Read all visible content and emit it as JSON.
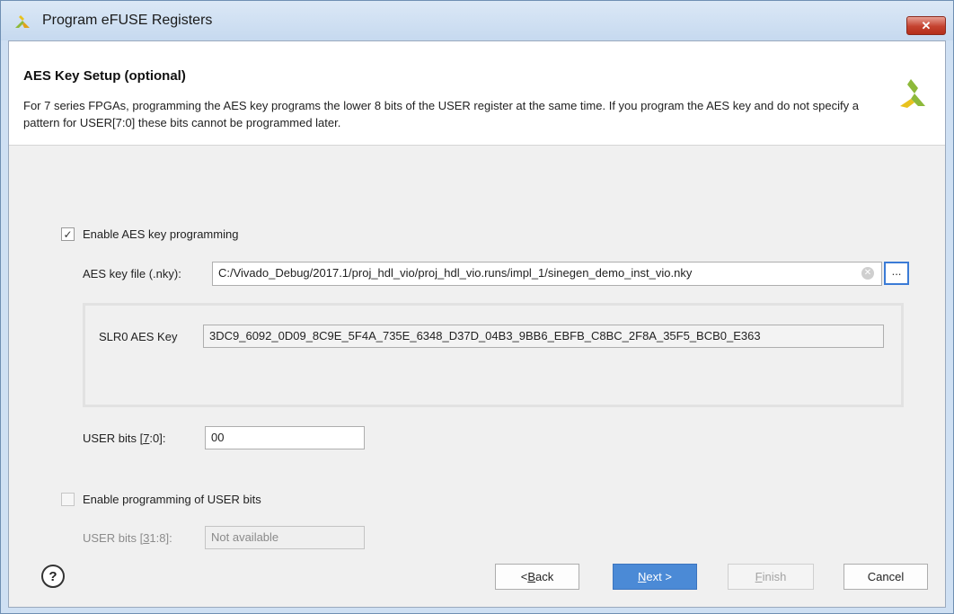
{
  "window": {
    "title": "Program eFUSE Registers",
    "close_symbol": "✕"
  },
  "header": {
    "title": "AES Key Setup (optional)",
    "description": "For 7 series FPGAs, programming the AES key programs the lower 8 bits of the USER register at the same time. If you program the AES key and do not specify a pattern for USER[7:0] these bits cannot be programmed later."
  },
  "aes": {
    "enable_label": "Enable AES key programming",
    "enable_checked": true,
    "file_label": "AES key file (.nky):",
    "file_value": "C:/Vivado_Debug/2017.1/proj_hdl_vio/proj_hdl_vio.runs/impl_1/sinegen_demo_inst_vio.nky",
    "browse_label": "...",
    "slr_label": "SLR0 AES Key",
    "slr_value": "3DC9_6092_0D09_8C9E_5F4A_735E_6348_D37D_04B3_9BB6_EBFB_C8BC_2F8A_35F5_BCB0_E363",
    "user_bits_label_prefix": "USER bits [",
    "user_bits_label_key": "7",
    "user_bits_label_suffix": ":0]:",
    "user_bits_value": "00"
  },
  "user": {
    "enable_label": "Enable programming of USER bits",
    "enable_checked": false,
    "bits_label_prefix": "USER bits [",
    "bits_label_key": "3",
    "bits_label_suffix": "1:8]:",
    "bits_value": "Not available"
  },
  "footer": {
    "help_symbol": "?",
    "back_prefix": "< ",
    "back_key": "B",
    "back_rest": "ack",
    "next_key": "N",
    "next_rest": "ext >",
    "finish_key": "F",
    "finish_rest": "inish",
    "cancel_label": "Cancel"
  },
  "colors": {
    "accent": "#4b8ad6",
    "logo_green": "#8db93a",
    "logo_yellow": "#e8c21e"
  }
}
